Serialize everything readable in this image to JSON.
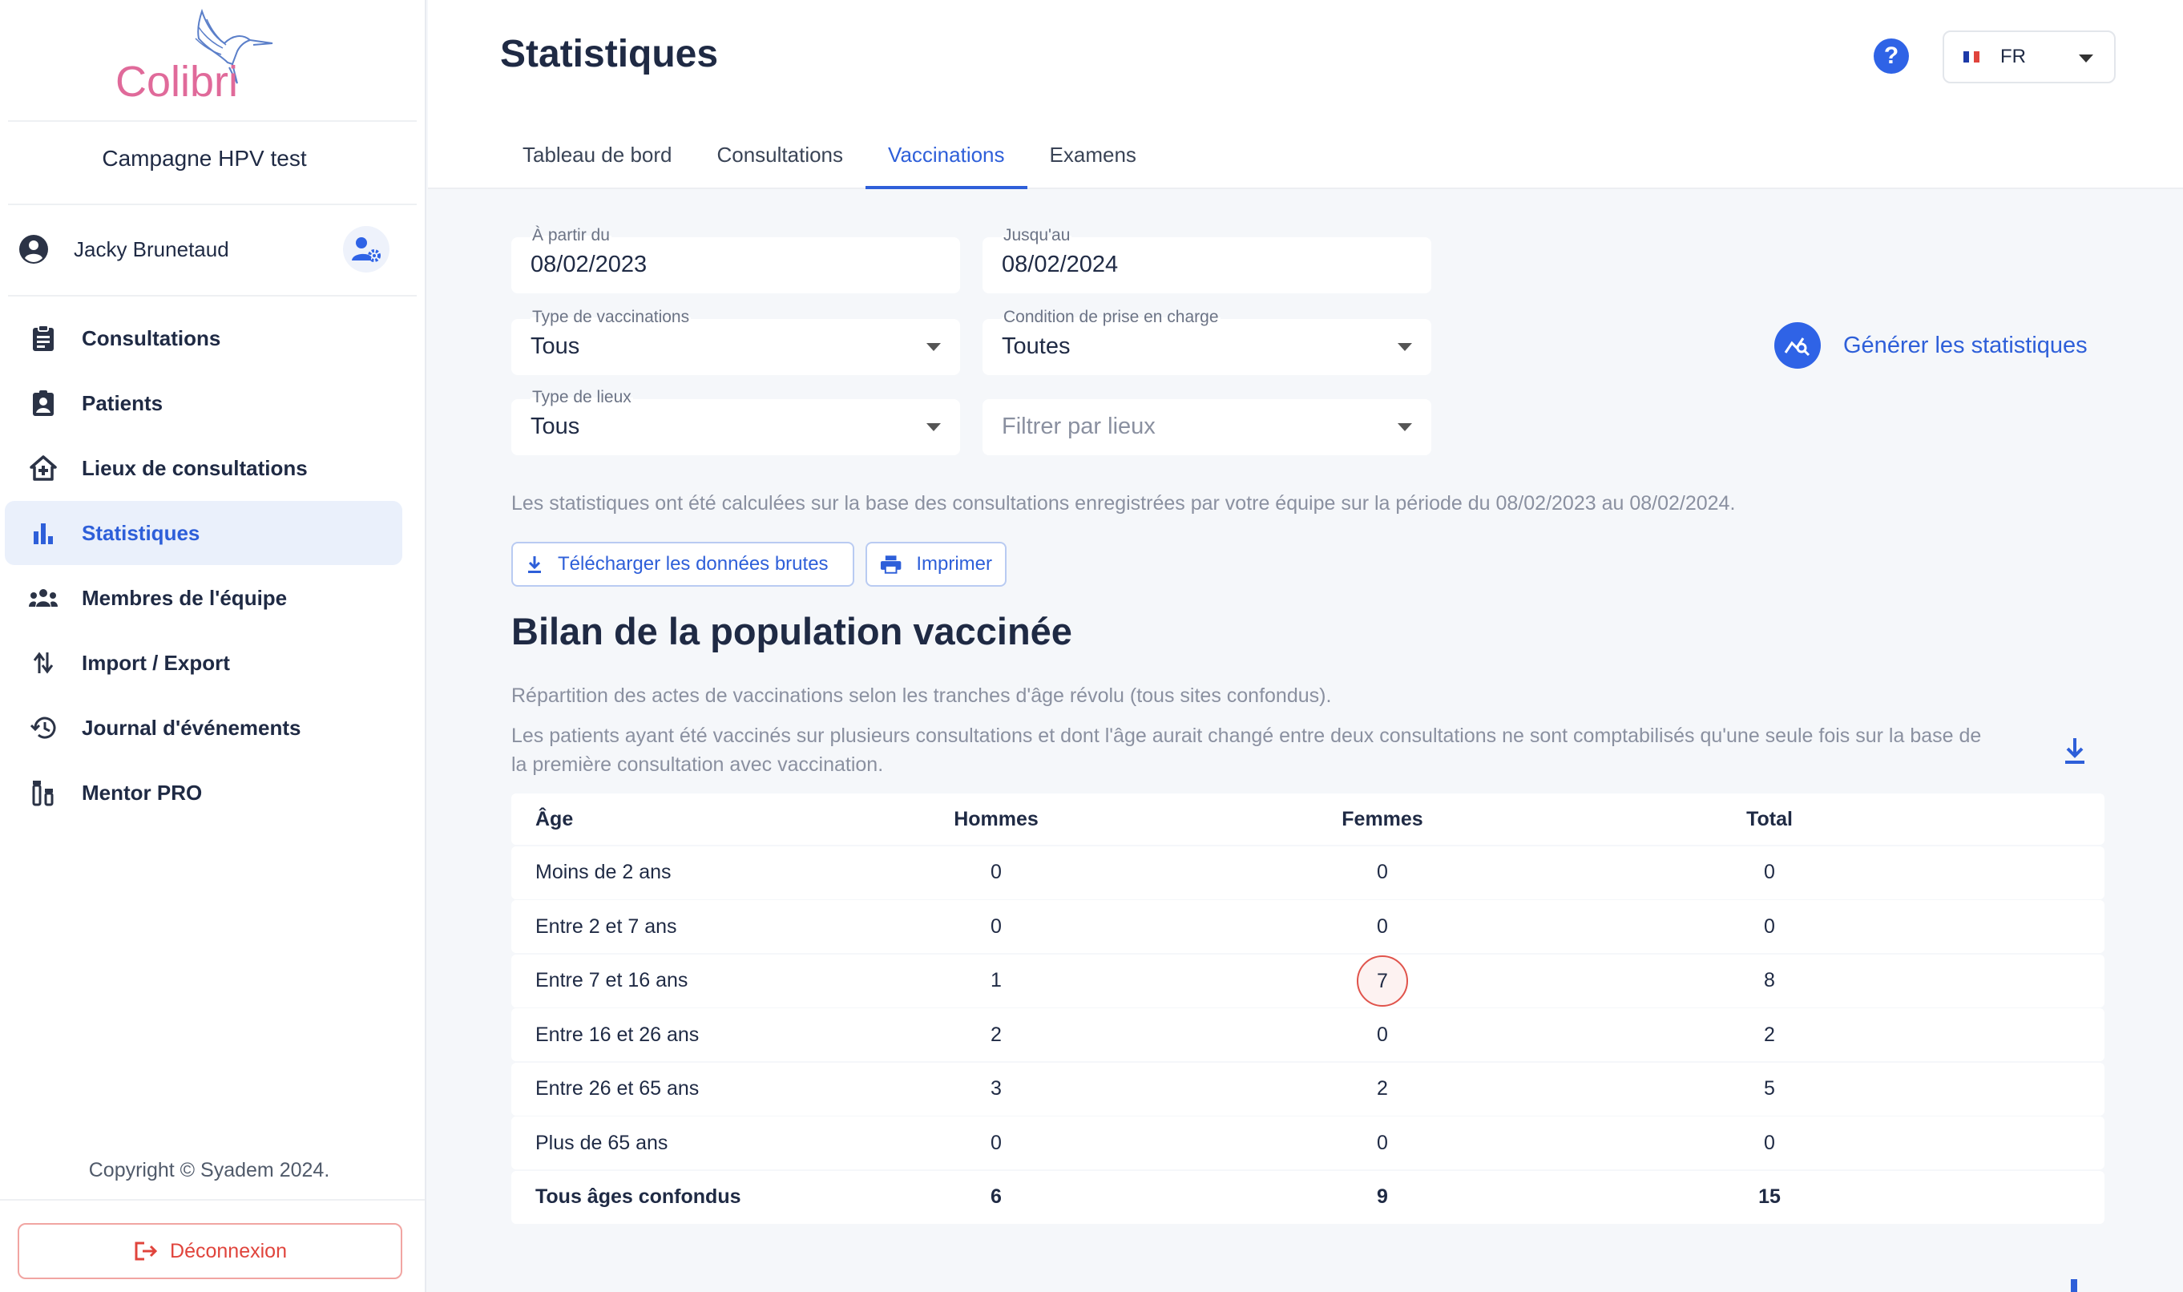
{
  "sidebar": {
    "logo_text": "Colibri",
    "campaign": "Campagne HPV test",
    "user_name": "Jacky Brunetaud",
    "nav_items": [
      {
        "label": "Consultations",
        "icon": "clipboard-icon"
      },
      {
        "label": "Patients",
        "icon": "patient-badge-icon"
      },
      {
        "label": "Lieux de consultations",
        "icon": "home-plus-icon"
      },
      {
        "label": "Statistiques",
        "icon": "bar-chart-icon",
        "active": true
      },
      {
        "label": "Membres de l'équipe",
        "icon": "team-icon"
      },
      {
        "label": "Import / Export",
        "icon": "import-export-icon"
      },
      {
        "label": "Journal d'événements",
        "icon": "history-icon"
      },
      {
        "label": "Mentor PRO",
        "icon": "vaccine-vial-icon"
      }
    ],
    "copyright": "Copyright © Syadem 2024.",
    "logout": "Déconnexion"
  },
  "header": {
    "title": "Statistiques",
    "help": "?",
    "language": "FR",
    "tabs": [
      {
        "label": "Tableau de bord"
      },
      {
        "label": "Consultations"
      },
      {
        "label": "Vaccinations",
        "active": true
      },
      {
        "label": "Examens"
      }
    ]
  },
  "filters": {
    "from_label": "À partir du",
    "from_value": "08/02/2023",
    "to_label": "Jusqu'au",
    "to_value": "08/02/2024",
    "vacc_type_label": "Type de vaccinations",
    "vacc_type_value": "Tous",
    "condition_label": "Condition de prise en charge",
    "condition_value": "Toutes",
    "place_type_label": "Type de lieux",
    "place_type_value": "Tous",
    "place_filter_placeholder": "Filtrer par lieux",
    "generate": "Générer les statistiques"
  },
  "info_text": "Les statistiques ont été calculées sur la base des consultations enregistrées par votre équipe sur la période du 08/02/2023 au 08/02/2024.",
  "actions": {
    "download_raw": "Télécharger les données brutes",
    "print": "Imprimer"
  },
  "section": {
    "title": "Bilan de la population vaccinée",
    "desc1": "Répartition des actes de vaccinations selon les tranches d'âge révolu (tous sites confondus).",
    "desc2_line1": "Les patients ayant été vaccinés sur plusieurs consultations et dont l'âge aurait changé entre deux consultations ne sont comptabilisés qu'une seule fois sur la base de",
    "desc2_line2": "la première consultation avec vaccination."
  },
  "table": {
    "headers": [
      "Âge",
      "Hommes",
      "Femmes",
      "Total"
    ],
    "rows": [
      [
        "Moins de 2 ans",
        "0",
        "0",
        "0"
      ],
      [
        "Entre 2 et 7 ans",
        "0",
        "0",
        "0"
      ],
      [
        "Entre 7 et 16 ans",
        "1",
        "7",
        "8"
      ],
      [
        "Entre 16 et 26 ans",
        "2",
        "0",
        "2"
      ],
      [
        "Entre 26 et 65 ans",
        "3",
        "2",
        "5"
      ],
      [
        "Plus de 65 ans",
        "0",
        "0",
        "0"
      ]
    ],
    "footer": [
      "Tous âges confondus",
      "6",
      "9",
      "15"
    ]
  },
  "colors": {
    "accent": "#2e5fd9",
    "danger": "#e0443c",
    "logo_pink": "#e06a9a",
    "logo_blue": "#5b7fc9"
  }
}
